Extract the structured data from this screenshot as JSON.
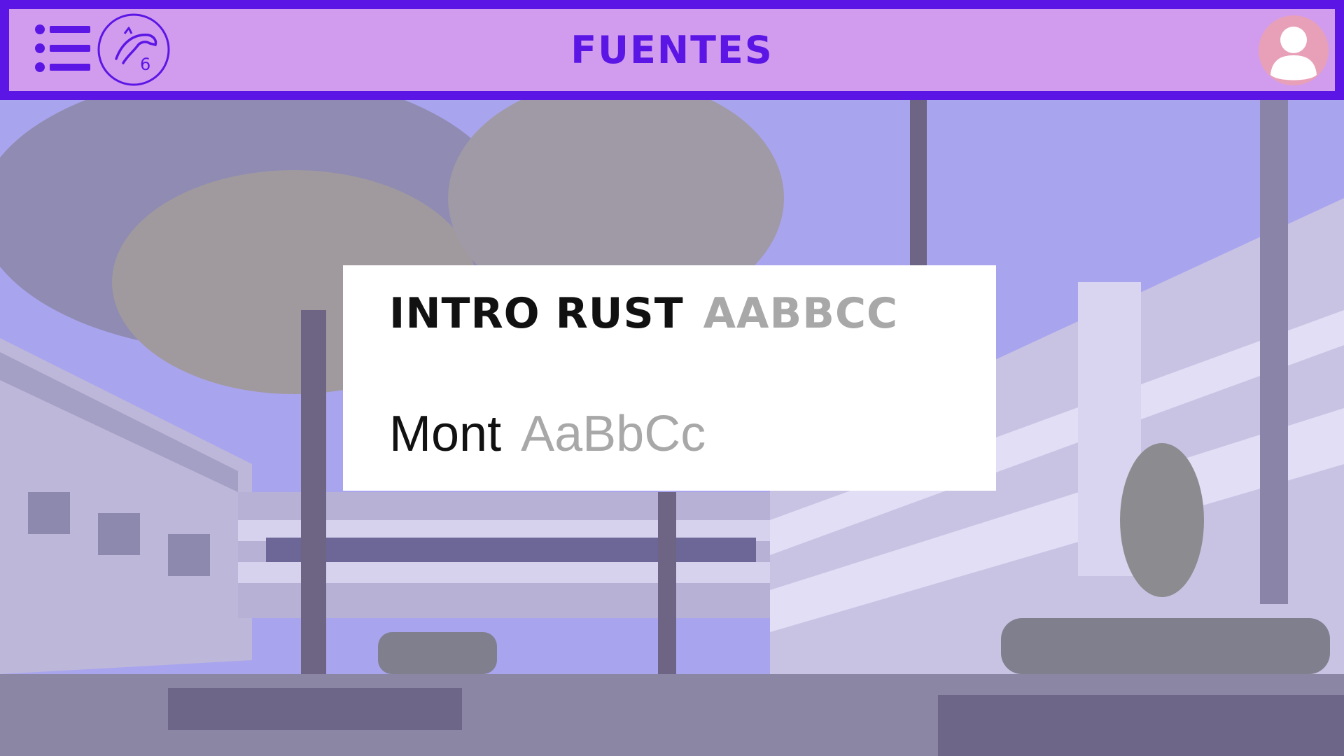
{
  "header": {
    "title": "FUENTES",
    "menu_icon": "list-icon",
    "logo_icon": "wolf-logo",
    "logo_mark": "6",
    "avatar_icon": "user-avatar-icon"
  },
  "font_card": {
    "rows": [
      {
        "font_name": "INTRO RUST",
        "sample": "AABBCC"
      },
      {
        "font_name": "Mont",
        "sample": "AaBbCc"
      }
    ]
  },
  "colors": {
    "accent": "#5b16e6",
    "header_bg": "#d19ced",
    "avatar_bg": "#e8a0b8",
    "sample_gray": "#a8a8a8",
    "font_name_black": "#111111"
  }
}
